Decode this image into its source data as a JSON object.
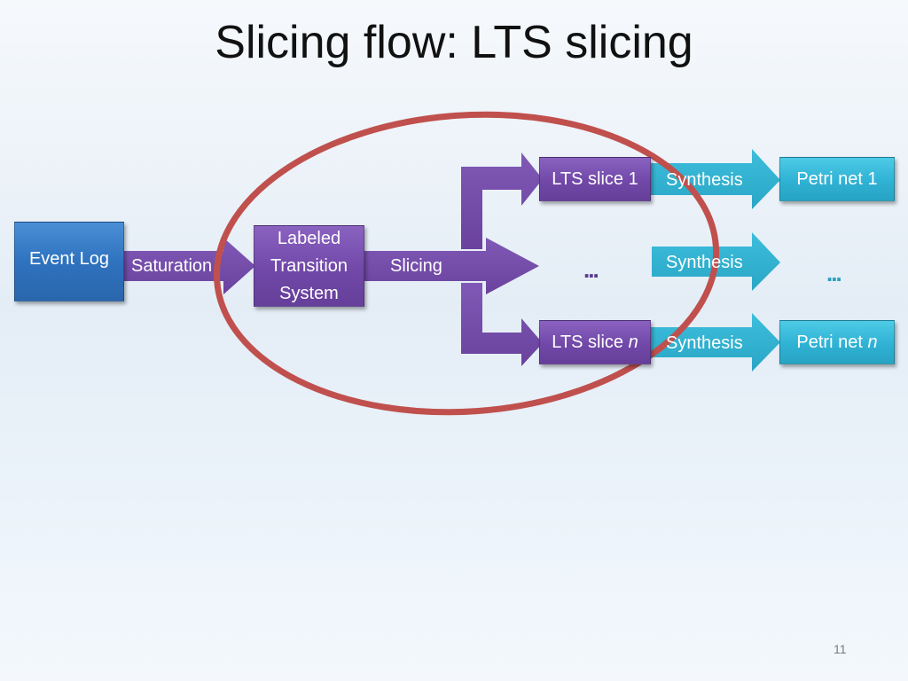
{
  "slide": {
    "title": "Slicing flow: LTS slicing",
    "page_number": "11"
  },
  "nodes": {
    "event_log": "Event Log",
    "lts_line1": "Labeled",
    "lts_line2": "Transition",
    "lts_line3": "System",
    "lts_slice_1": "LTS slice 1",
    "lts_slice_n_prefix": "LTS slice ",
    "lts_slice_n_var": "n",
    "petri_net_1": "Petri net 1",
    "petri_net_n_prefix": "Petri net ",
    "petri_net_n_var": "n",
    "ellipsis_purple": "...",
    "ellipsis_teal": "..."
  },
  "arrows": {
    "saturation": "Saturation",
    "slicing": "Slicing",
    "synthesis_1": "Synthesis",
    "synthesis_mid": "Synthesis",
    "synthesis_n": "Synthesis"
  },
  "colors": {
    "blue": "#2f72bf",
    "purple": "#7148a8",
    "teal": "#2fb2d4",
    "highlight_ellipse": "#c0504d"
  }
}
